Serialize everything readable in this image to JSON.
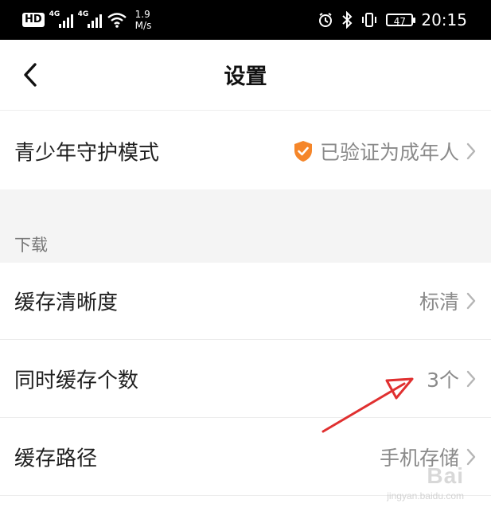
{
  "status_bar": {
    "hd": "HD",
    "sim1_tag": "4G",
    "sim2_tag": "4G",
    "speed_value": "1.9",
    "speed_unit": "M/s",
    "battery": "47",
    "time": "20:15",
    "icons": [
      "alarm-icon",
      "bluetooth-icon",
      "vibrate-icon"
    ]
  },
  "header": {
    "title": "设置",
    "back_icon": "chevron-left-icon"
  },
  "teen_mode": {
    "label": "青少年守护模式",
    "value": "已验证为成年人",
    "badge_icon": "shield-check-icon",
    "badge_color": "#f5862a"
  },
  "download_section": {
    "title": "下载",
    "rows": [
      {
        "label": "缓存清晰度",
        "value": "标清"
      },
      {
        "label": "同时缓存个数",
        "value": "3个"
      },
      {
        "label": "缓存路径",
        "value": "手机存储"
      }
    ]
  },
  "annotation": {
    "arrow_color": "#e03030"
  },
  "watermark": {
    "main": "Bai",
    "sub": "jingyan.baidu.com"
  }
}
